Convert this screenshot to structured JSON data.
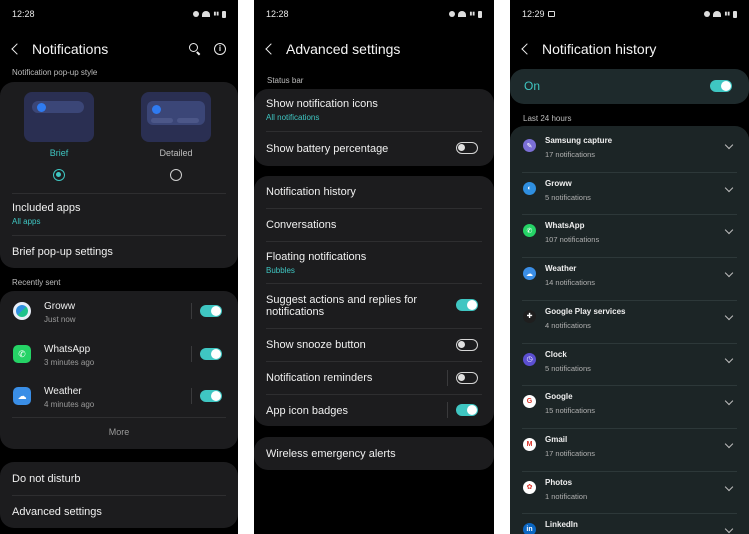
{
  "screen1": {
    "status_time": "12:28",
    "title": "Notifications",
    "popup_style_label": "Notification pop-up style",
    "options": [
      {
        "label": "Brief",
        "selected": true
      },
      {
        "label": "Detailed",
        "selected": false
      }
    ],
    "included_apps": {
      "title": "Included apps",
      "sub": "All apps"
    },
    "brief_settings": "Brief pop-up settings",
    "recently_sent_label": "Recently sent",
    "apps": [
      {
        "name": "Groww",
        "time": "Just now",
        "on": true
      },
      {
        "name": "WhatsApp",
        "time": "3 minutes ago",
        "on": true
      },
      {
        "name": "Weather",
        "time": "4 minutes ago",
        "on": true
      }
    ],
    "more": "More",
    "dnd": "Do not disturb",
    "advanced": "Advanced settings"
  },
  "screen2": {
    "status_time": "12:28",
    "title": "Advanced settings",
    "status_bar_label": "Status bar",
    "show_icons": {
      "title": "Show notification icons",
      "sub": "All notifications"
    },
    "battery": {
      "title": "Show battery percentage",
      "on": false
    },
    "history": "Notification history",
    "conversations": "Conversations",
    "floating": {
      "title": "Floating notifications",
      "sub": "Bubbles"
    },
    "suggest": {
      "title": "Suggest actions and replies for notifications",
      "on": true
    },
    "snooze": {
      "title": "Show snooze button",
      "on": false
    },
    "reminders": {
      "title": "Notification reminders",
      "on": false
    },
    "badges": {
      "title": "App icon badges",
      "on": true
    },
    "emergency": "Wireless emergency alerts"
  },
  "screen3": {
    "status_time": "12:29",
    "title": "Notification history",
    "on_label": "On",
    "last24": "Last 24 hours",
    "items": [
      {
        "name": "Samsung capture",
        "count": "17 notifications",
        "color": "#7b6fd6",
        "glyph": "✎"
      },
      {
        "name": "Groww",
        "count": "5 notifications",
        "color": "#2f8fe0",
        "glyph": "◐"
      },
      {
        "name": "WhatsApp",
        "count": "107 notifications",
        "color": "#25d366",
        "glyph": "✆"
      },
      {
        "name": "Weather",
        "count": "14 notifications",
        "color": "#3a8ee6",
        "glyph": "☁"
      },
      {
        "name": "Google Play services",
        "count": "4 notifications",
        "color": "#1e1e1e",
        "glyph": "✚"
      },
      {
        "name": "Clock",
        "count": "5 notifications",
        "color": "#5b4fd1",
        "glyph": "◷"
      },
      {
        "name": "Google",
        "count": "15 notifications",
        "color": "#ffffff",
        "glyph": "G"
      },
      {
        "name": "Gmail",
        "count": "17 notifications",
        "color": "#ffffff",
        "glyph": "M"
      },
      {
        "name": "Photos",
        "count": "1 notification",
        "color": "#ffffff",
        "glyph": "✿"
      },
      {
        "name": "LinkedIn",
        "count": "",
        "color": "#0a66c2",
        "glyph": "in"
      }
    ]
  }
}
